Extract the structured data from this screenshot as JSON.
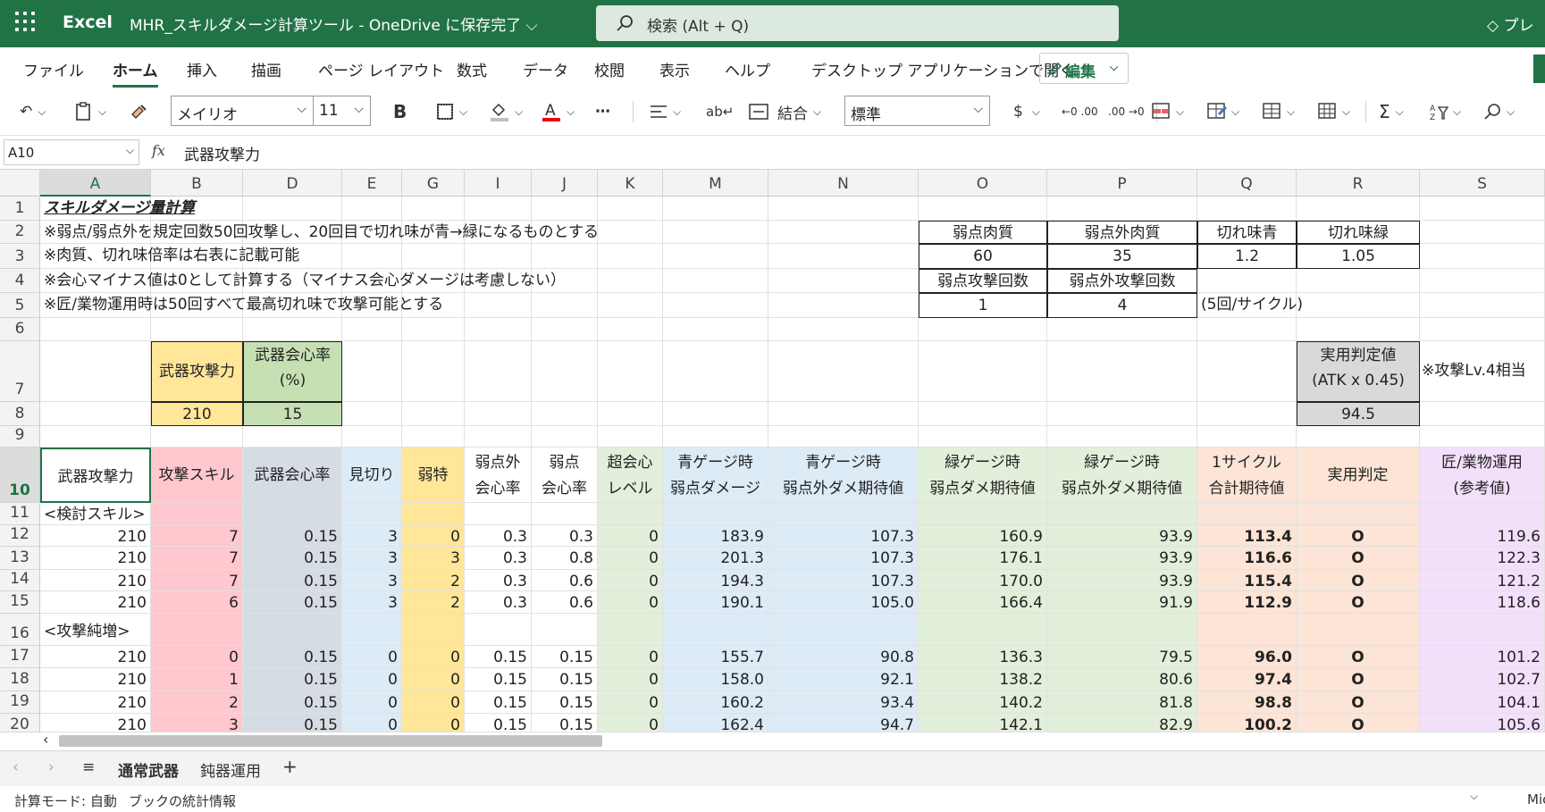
{
  "app": {
    "name": "Excel",
    "doc_title": "MHR_スキルダメージ計算ツール - OneDrive に保存完了 ⌵",
    "search": "検索 (Alt + Q)",
    "premium": "プレ"
  },
  "menu": [
    "ファイル",
    "ホーム",
    "挿入",
    "描画",
    "ページ レイアウト",
    "数式",
    "データ",
    "校閲",
    "表示",
    "ヘルプ",
    "デスクトップ アプリケーションで開く"
  ],
  "edit_button": "編集",
  "toolbar": {
    "font": "メイリオ",
    "size": "11",
    "bold": "B",
    "merge": "結合",
    "number_format": "標準",
    "currency": "$",
    "dec1": "←0 .00",
    "dec2": ".00 →0",
    "sum": "Σ"
  },
  "namebox": "A10",
  "formula": "武器攻撃力",
  "columns": [
    "A",
    "B",
    "D",
    "E",
    "G",
    "I",
    "J",
    "K",
    "M",
    "N",
    "O",
    "P",
    "Q",
    "R",
    "S"
  ],
  "rows": [
    "1",
    "2",
    "3",
    "4",
    "5",
    "6",
    "7",
    "8",
    "9",
    "10",
    "11",
    "12",
    "13",
    "14",
    "15",
    "16",
    "17",
    "18",
    "19",
    "20"
  ],
  "notes": {
    "title": "スキルダメージ量計算",
    "n2": "※弱点/弱点外を規定回数50回攻撃し、20回目で切れ味が青→緑になるものとする",
    "n3": "※肉質、切れ味倍率は右表に記載可能",
    "n4": "※会心マイナス値は0として計算する（マイナス会心ダメージは考慮しない）",
    "n5": "※匠/業物運用時は50回すべて最高切れ味で攻撃可能とする"
  },
  "params": {
    "weak_flesh_h": "弱点肉質",
    "nonweak_flesh_h": "弱点外肉質",
    "sharp_blue_h": "切れ味青",
    "sharp_green_h": "切れ味緑",
    "weak_flesh": "60",
    "nonweak_flesh": "35",
    "sharp_blue": "1.2",
    "sharp_green": "1.05",
    "weak_hits_h": "弱点攻撃回数",
    "nonweak_hits_h": "弱点外攻撃回数",
    "weak_hits": "1",
    "nonweak_hits": "4",
    "cycle": "(5回/サイクル)"
  },
  "weapon": {
    "atk_h": "武器攻撃力",
    "crit_h1": "武器会心率",
    "crit_h2": "(%)",
    "atk": "210",
    "crit": "15"
  },
  "practical": {
    "h1": "実用判定値",
    "h2": "(ATK x 0.45)",
    "value": "94.5",
    "note": "※攻撃Lv.4相当"
  },
  "headers": [
    [
      "武器攻撃力"
    ],
    [
      "攻撃スキル"
    ],
    [
      "武器会心率"
    ],
    [
      "見切り"
    ],
    [
      "弱特"
    ],
    [
      "弱点外",
      "会心率"
    ],
    [
      "弱点",
      "会心率"
    ],
    [
      "超会心",
      "レベル"
    ],
    [
      "青ゲージ時",
      "弱点ダメージ"
    ],
    [
      "青ゲージ時",
      "弱点外ダメ期待値"
    ],
    [
      "緑ゲージ時",
      "弱点ダメ期待値"
    ],
    [
      "緑ゲージ時",
      "弱点外ダメ期待値"
    ],
    [
      "1サイクル",
      "合計期待値"
    ],
    [
      "実用判定"
    ],
    [
      "匠/業物運用",
      "(参考値)"
    ]
  ],
  "section1": "<検討スキル>",
  "section2": "<攻撃純増>",
  "rows1": [
    [
      "210",
      "7",
      "0.15",
      "3",
      "0",
      "0.3",
      "0.3",
      "0",
      "183.9",
      "107.3",
      "160.9",
      "93.9",
      "113.4",
      "O",
      "119.6"
    ],
    [
      "210",
      "7",
      "0.15",
      "3",
      "3",
      "0.3",
      "0.8",
      "0",
      "201.3",
      "107.3",
      "176.1",
      "93.9",
      "116.6",
      "O",
      "122.3"
    ],
    [
      "210",
      "7",
      "0.15",
      "3",
      "2",
      "0.3",
      "0.6",
      "0",
      "194.3",
      "107.3",
      "170.0",
      "93.9",
      "115.4",
      "O",
      "121.2"
    ],
    [
      "210",
      "6",
      "0.15",
      "3",
      "2",
      "0.3",
      "0.6",
      "0",
      "190.1",
      "105.0",
      "166.4",
      "91.9",
      "112.9",
      "O",
      "118.6"
    ]
  ],
  "rows2": [
    [
      "210",
      "0",
      "0.15",
      "0",
      "0",
      "0.15",
      "0.15",
      "0",
      "155.7",
      "90.8",
      "136.3",
      "79.5",
      "96.0",
      "O",
      "101.2"
    ],
    [
      "210",
      "1",
      "0.15",
      "0",
      "0",
      "0.15",
      "0.15",
      "0",
      "158.0",
      "92.1",
      "138.2",
      "80.6",
      "97.4",
      "O",
      "102.7"
    ],
    [
      "210",
      "2",
      "0.15",
      "0",
      "0",
      "0.15",
      "0.15",
      "0",
      "160.2",
      "93.4",
      "140.2",
      "81.8",
      "98.8",
      "O",
      "104.1"
    ],
    [
      "210",
      "3",
      "0.15",
      "0",
      "0",
      "0.15",
      "0.15",
      "0",
      "162.4",
      "94.7",
      "142.1",
      "82.9",
      "100.2",
      "O",
      "105.6"
    ]
  ],
  "sheets": [
    "通常武器",
    "鈍器運用"
  ],
  "status": {
    "mode": "計算モード: 自動",
    "stats": "ブックの統計情報",
    "right": "Mic"
  },
  "colors": {
    "excel_green": "#217346",
    "yellow": "#ffe699",
    "green": "#c6e0b4",
    "pink": "#ffc7ce",
    "blue_grey": "#d6dce4",
    "light_blue": "#ddebf7",
    "light_green": "#e2efda",
    "peach": "#fce4d6",
    "lavender": "#f2e0fb",
    "grey": "#d9d9d9"
  }
}
